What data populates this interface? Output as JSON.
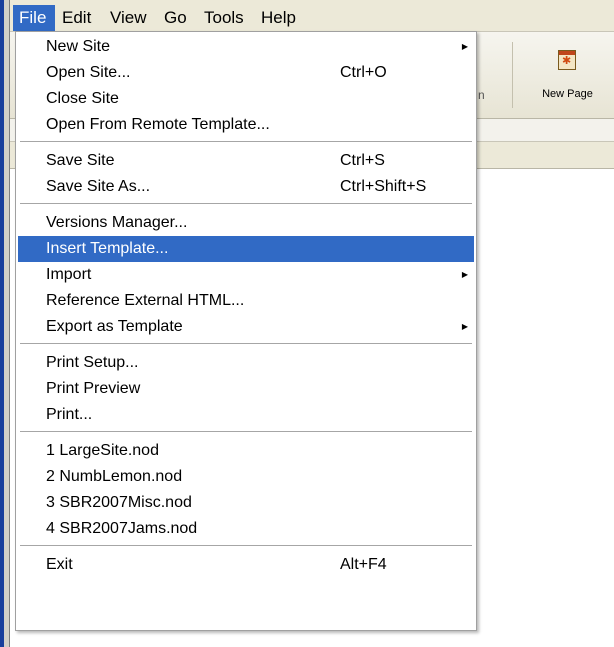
{
  "menubar": {
    "items": [
      {
        "label": "File",
        "active": true
      },
      {
        "label": "Edit"
      },
      {
        "label": "View"
      },
      {
        "label": "Go"
      },
      {
        "label": "Tools"
      },
      {
        "label": "Help"
      }
    ]
  },
  "toolbar": {
    "new_page_label": "New Page",
    "new_page_icon": "new-page-icon",
    "cut_off_label_char": "n"
  },
  "file_menu": {
    "groups": [
      [
        {
          "label": "New Site",
          "submenu": true
        },
        {
          "label": "Open Site...",
          "shortcut": "Ctrl+O"
        },
        {
          "label": "Close Site"
        },
        {
          "label": "Open From Remote Template..."
        }
      ],
      [
        {
          "label": "Save Site",
          "shortcut": "Ctrl+S"
        },
        {
          "label": "Save Site As...",
          "shortcut": "Ctrl+Shift+S"
        }
      ],
      [
        {
          "label": "Versions Manager..."
        },
        {
          "label": "Insert Template...",
          "highlighted": true
        },
        {
          "label": "Import",
          "submenu": true
        },
        {
          "label": "Reference External HTML..."
        },
        {
          "label": "Export as Template",
          "submenu": true
        }
      ],
      [
        {
          "label": "Print Setup..."
        },
        {
          "label": "Print Preview"
        },
        {
          "label": "Print..."
        }
      ],
      [
        {
          "label": "1 LargeSite.nod"
        },
        {
          "label": "2 NumbLemon.nod"
        },
        {
          "label": "3 SBR2007Misc.nod"
        },
        {
          "label": "4 SBR2007Jams.nod"
        }
      ],
      [
        {
          "label": "Exit",
          "shortcut": "Alt+F4"
        }
      ]
    ]
  },
  "colors": {
    "highlight": "#316ac5",
    "menubar_bg": "#ece9d8",
    "left_accent": "#1a3f9c"
  }
}
